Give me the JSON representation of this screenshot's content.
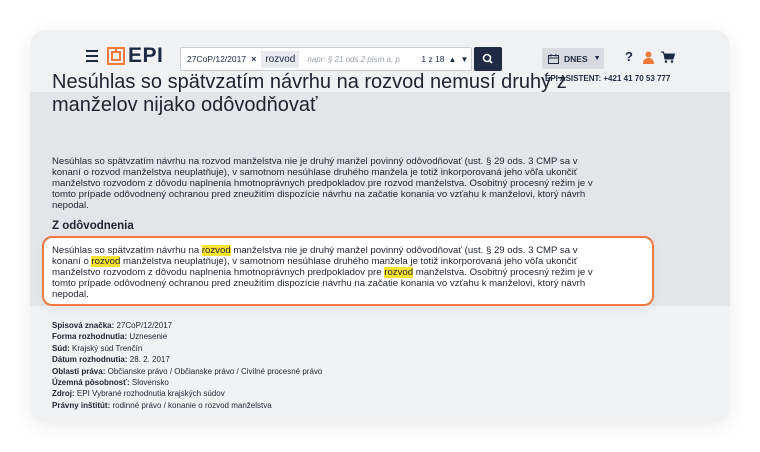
{
  "header": {
    "logo_text": "EPI",
    "search": {
      "chip": "27CoP/12/2017",
      "term": "rozvod",
      "placeholder": "napr: § 21 ods 2 pism a, p",
      "counter": "1 z 18"
    },
    "date_filter": "DNES",
    "help": "?",
    "assistant": "EPI ASISTENT:  +421 41 70 53 777"
  },
  "article": {
    "title": "Nesúhlas so spätvzatím návrhu na rozvod nemusí druhý z manželov nijako odôvodňovať",
    "summary_lines": [
      "Nesúhlas so spätvzatím návrhu na rozvod manželstva nie je druhý manžel povinný odôvodňovať (ust. § 29 ods. 3 CMP sa v",
      "konaní o rozvod manželstva neuplatňuje), v samotnom nesúhlase druhého manžela je totiž inkorporovaná jeho vôľa ukončiť",
      "manželstvo rozvodom z dôvodu naplnenia hmotnoprávnych predpokladov pre rozvod manželstva. Osobitný procesný režim je v",
      "tomto prípade odôvodnený ochranou pred zneužitím dispozície návrhu na začatie konania vo vzťahu k manželovi, ktorý návrh",
      "nepodal."
    ],
    "section_title": "Z odôvodnenia",
    "highlight": {
      "l1_a": "Nesúhlas so spätvzatím návrhu na ",
      "l1_m": "rozvod",
      "l1_b": " manželstva nie je druhý manžel povinný odôvodňovať (ust. § 29 ods. 3 CMP sa v",
      "l2_a": "konaní o ",
      "l2_m": "rozvod",
      "l2_b": " manželstva neuplatňuje), v samotnom nesúhlase druhého manžela je totiž inkorporovaná jeho vôľa ukončiť",
      "l3_a": "manželstvo rozvodom z dôvodu naplnenia hmotnoprávnych predpokladov pre ",
      "l3_m": "rozvod",
      "l3_b": " manželstva. Osobitný procesný režim je v",
      "l4": "tomto prípade odôvodnený ochranou pred zneužitím dispozície návrhu na začatie konania vo vzťahu k manželovi, ktorý návrh",
      "l5": "nepodal."
    }
  },
  "meta": [
    {
      "label": "Spisová značka:",
      "value": "27CoP/12/2017"
    },
    {
      "label": "Forma rozhodnutia:",
      "value": "Uznesenie"
    },
    {
      "label": "Súd:",
      "value": "Krajský súd Trenčín"
    },
    {
      "label": "Dátum rozhodnutia:",
      "value": "28. 2. 2017"
    },
    {
      "label": "Oblasti práva:",
      "value": "Občianske právo / Občianske právo / Civilné procesné právo"
    },
    {
      "label": "Územná pôsobnosť:",
      "value": "Slovensko"
    },
    {
      "label": "Zdroj:",
      "value": "EPI Vybrané rozhodnutia krajských súdov"
    },
    {
      "label": "Právny inštitút:",
      "value": "rodinné právo / konanie o rozvod manželstva"
    }
  ],
  "colors": {
    "accent": "#ef7a3b",
    "navy": "#1e2a44",
    "highlight": "#f7e22d"
  }
}
